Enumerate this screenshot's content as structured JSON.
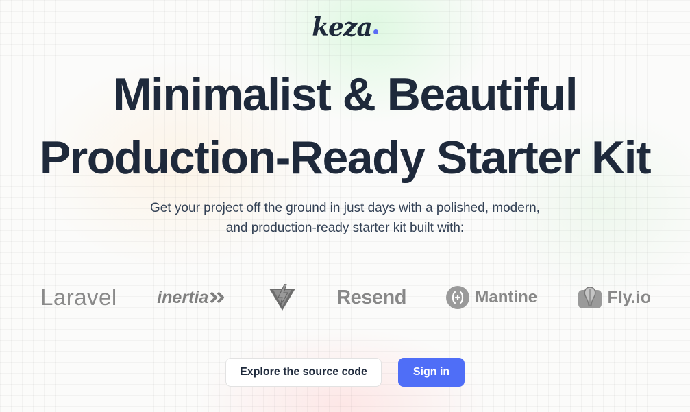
{
  "brand": {
    "name": "keza",
    "dot_color": "#5b6cf5"
  },
  "hero": {
    "title_line1": "Minimalist & Beautiful",
    "title_line2": "Production-Ready Starter Kit",
    "subtitle_line1": "Get your project off the ground in just days with a polished, modern,",
    "subtitle_line2": "and production-ready starter kit built with:"
  },
  "tech_logos": [
    {
      "name": "Laravel",
      "icon": "laravel-wordmark"
    },
    {
      "name": "inertia",
      "icon": "double-chevron-right-icon"
    },
    {
      "name": "",
      "icon": "vite-icon"
    },
    {
      "name": "Resend",
      "icon": "resend-wordmark"
    },
    {
      "name": "Mantine",
      "icon": "mantine-icon"
    },
    {
      "name": "Fly.io",
      "icon": "fly-balloon-icon"
    }
  ],
  "actions": {
    "explore_label": "Explore the source code",
    "signin_label": "Sign in"
  },
  "colors": {
    "heading": "#1e293b",
    "primary": "#4f6ef7",
    "logo_gray": "#8a8a8a"
  }
}
